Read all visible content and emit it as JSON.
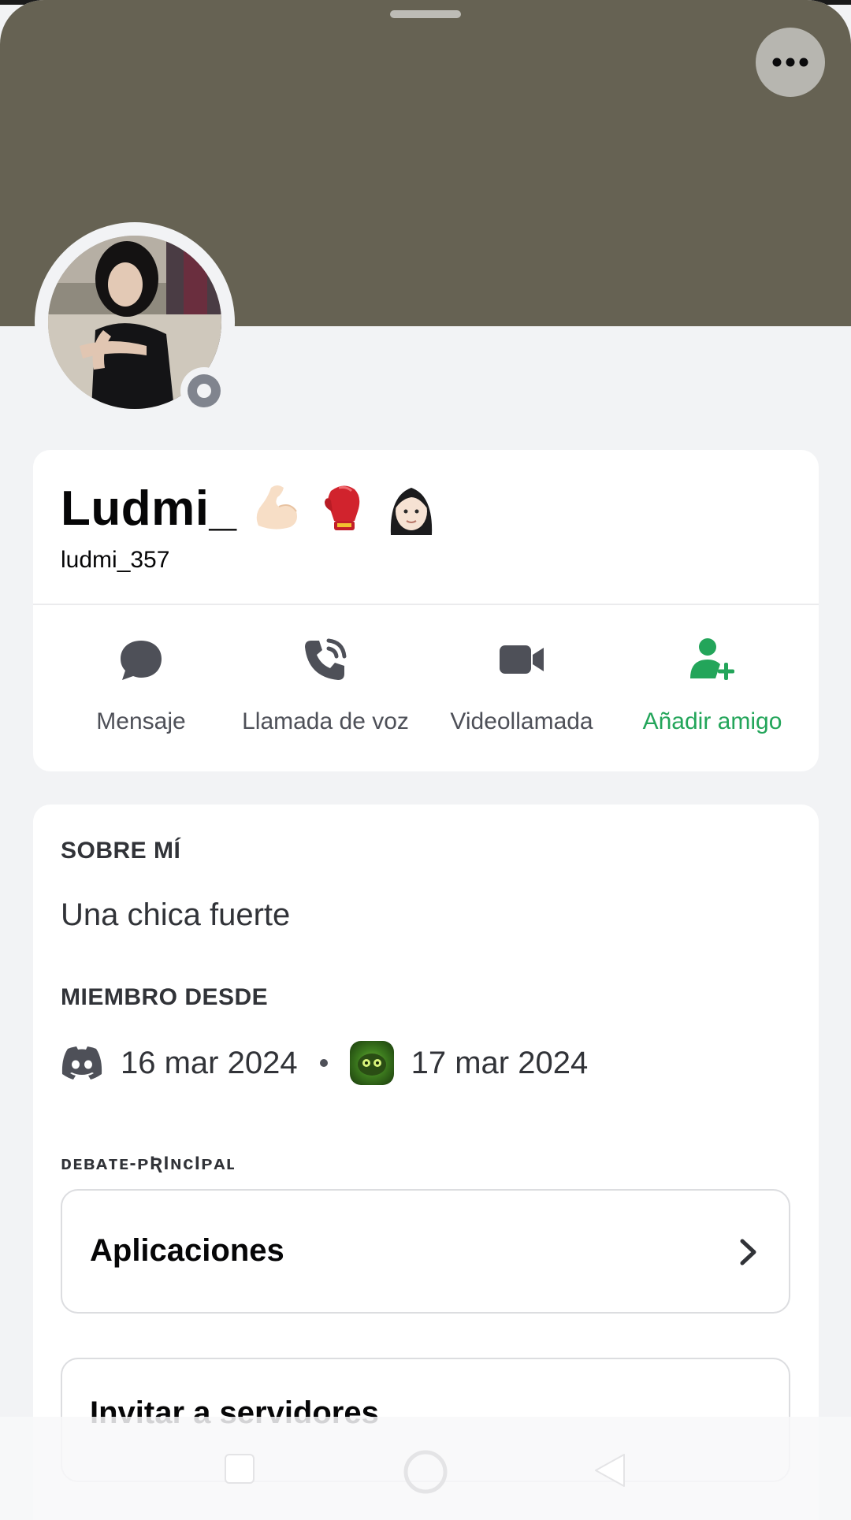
{
  "profile": {
    "display_name": "Ludmi_",
    "username": "ludmi_357",
    "status": "offline",
    "badge_emojis": [
      "flexed-biceps",
      "boxing-glove",
      "woman-light-skin"
    ]
  },
  "actions": [
    {
      "label": "Mensaje",
      "icon": "message-bubble-icon"
    },
    {
      "label": "Llamada de voz",
      "icon": "phone-call-icon"
    },
    {
      "label": "Videollamada",
      "icon": "video-camera-icon"
    },
    {
      "label": "Añadir amigo",
      "icon": "add-friend-icon",
      "color": "#23a55a"
    }
  ],
  "about": {
    "title": "SOBRE MÍ",
    "text": "Una chica fuerte"
  },
  "member_since": {
    "title": "MIEMBRO DESDE",
    "discord_date": "16 mar 2024",
    "server_date": "17 mar 2024"
  },
  "channel": {
    "name": "ᴅᴇʙᴀᴛᴇ-ᴘƦIɴᴄIᴘᴀʟ"
  },
  "rows": [
    {
      "label": "Aplicaciones"
    },
    {
      "label": "Invitar a servidores"
    }
  ],
  "colors": {
    "banner": "#666253",
    "accent_green": "#23a55a",
    "background": "#f2f3f5"
  }
}
